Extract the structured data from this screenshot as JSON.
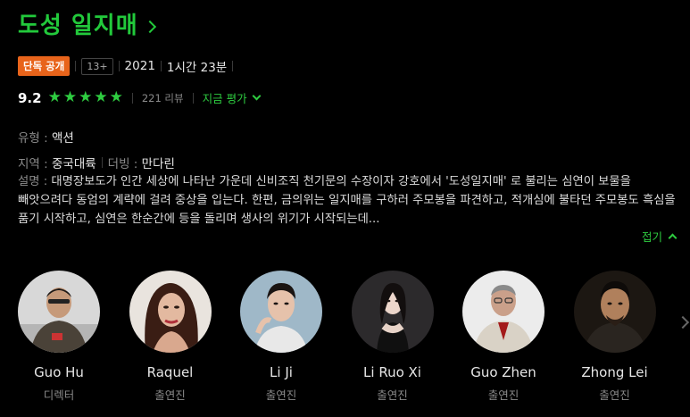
{
  "title": "도성 일지매",
  "meta": {
    "exclusive_badge": "단독 공개",
    "age_rating": "13+",
    "year": "2021",
    "duration": "1시간 23분"
  },
  "rating": {
    "score": "9.2",
    "stars_filled": 5,
    "stars_total": 5,
    "review_count": "221 리뷰",
    "rate_now": "지금 평가"
  },
  "info": {
    "genre_label": "유형 :",
    "genre_value": "액션",
    "region_label": "지역 :",
    "region_value": "중국대륙",
    "dub_label": "더빙 :",
    "dub_value": "만다린",
    "desc_label": "설명 :",
    "desc_value": "대명장보도가 인간 세상에 나타난 가운데 신비조직 천기문의 수장이자 강호에서 '도성일지매' 로 불리는 심연이 보물을 빼앗으려다 동엄의 계략에 걸려 중상을 입는다. 한편, 금의위는 일지매를 구하러 주모봉을 파견하고, 적개심에 불타던 주모봉도 흑심을 품기 시작하고, 심연은 한순간에 등을 돌리며 생사의 위기가 시작되는데...",
    "fold_label": "접기"
  },
  "cast": [
    {
      "name": "Guo Hu",
      "role": "디렉터"
    },
    {
      "name": "Raquel",
      "role": "출연진"
    },
    {
      "name": "Li Ji",
      "role": "출연진"
    },
    {
      "name": "Li Ruo Xi",
      "role": "출연진"
    },
    {
      "name": "Guo Zhen",
      "role": "출연진"
    },
    {
      "name": "Zhong Lei",
      "role": "출연진"
    }
  ],
  "colors": {
    "accent_green": "#22c93b",
    "badge_orange": "#e8641b",
    "background": "#000000"
  },
  "icons": {
    "title_chevron": "chevron-right-icon",
    "star": "star-icon",
    "rate_chevron": "chevron-down-icon",
    "fold_chevron": "chevron-up-icon",
    "next": "chevron-right-icon"
  }
}
